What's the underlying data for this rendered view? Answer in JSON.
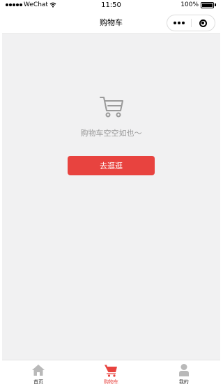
{
  "status_bar": {
    "carrier": "WeChat",
    "time": "11:50",
    "battery": "100%"
  },
  "nav": {
    "title": "购物车"
  },
  "empty": {
    "text": "购物车空空如也～",
    "button_label": "去逛逛"
  },
  "tabbar": {
    "items": [
      {
        "label": "首页",
        "icon": "home-icon",
        "active": false
      },
      {
        "label": "购物车",
        "icon": "cart-icon",
        "active": true
      },
      {
        "label": "我的",
        "icon": "user-icon",
        "active": false
      }
    ]
  },
  "colors": {
    "accent": "#e8433f",
    "background": "#f1f1f2",
    "inactive_icon": "#b9b9b9"
  }
}
